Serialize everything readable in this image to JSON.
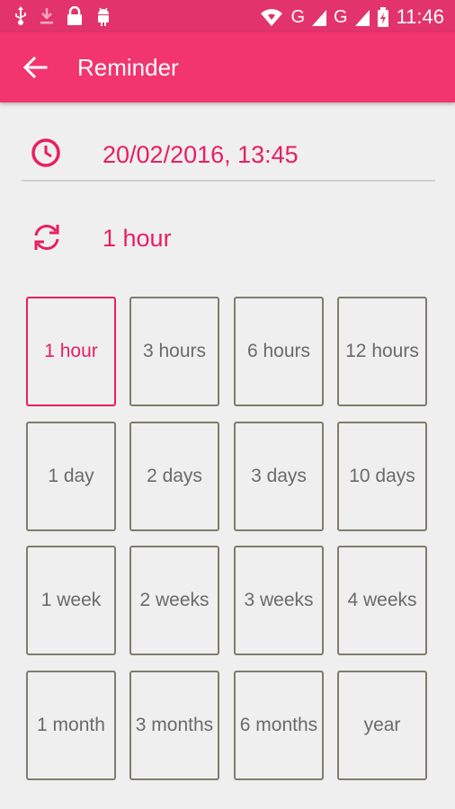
{
  "status_bar": {
    "network_1": "G",
    "network_2": "G",
    "time": "11:46"
  },
  "app_bar": {
    "title": "Reminder"
  },
  "reminder": {
    "datetime": "20/02/2016, 13:45",
    "repeat_value": "1 hour"
  },
  "intervals": [
    [
      "1 hour",
      "3 hours",
      "6 hours",
      "12 hours"
    ],
    [
      "1 day",
      "2 days",
      "3 days",
      "10 days"
    ],
    [
      "1 week",
      "2 weeks",
      "3 weeks",
      "4 weeks"
    ],
    [
      "1 month",
      "3 months",
      "6 months",
      "year"
    ]
  ],
  "selected_interval": "1 hour",
  "colors": {
    "primary": "#f2356f",
    "status_bar": "#e2336d",
    "accent": "#e91e63",
    "cell_border": "#7f7d6b",
    "background": "#efefef"
  }
}
